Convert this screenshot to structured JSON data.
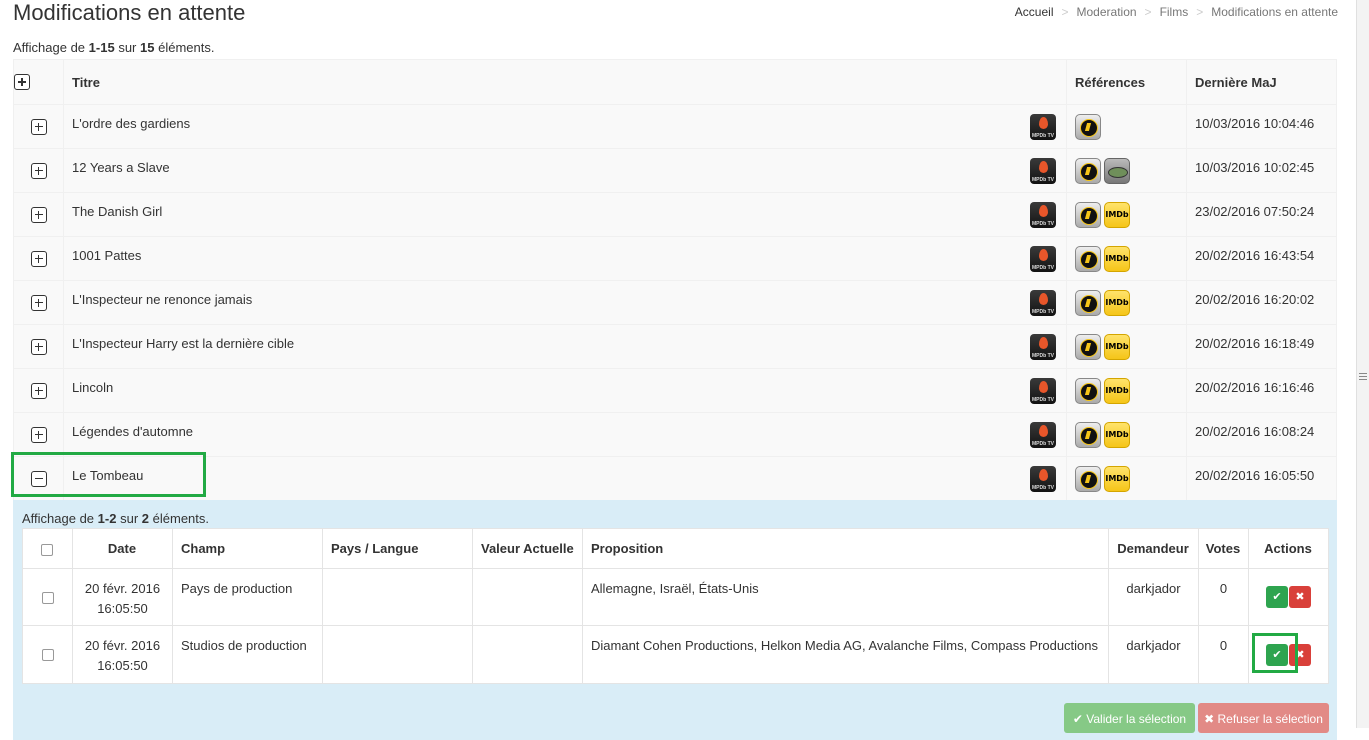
{
  "page": {
    "title": "Modifications en attente",
    "breadcrumb": [
      "Accueil",
      "Moderation",
      "Films",
      "Modifications en attente"
    ]
  },
  "summary": {
    "prefix": "Affichage de",
    "range": "1-15",
    "middle": "sur",
    "total": "15",
    "suffix": "éléments."
  },
  "main_table": {
    "headers": {
      "title": "Titre",
      "refs": "Références",
      "date": "Dernière MaJ"
    },
    "rows": [
      {
        "title": "L'ordre des gardiens",
        "refs": [
          "allocine"
        ],
        "date": "10/03/2016 10:04:46",
        "expanded": false
      },
      {
        "title": "12 Years a Slave",
        "refs": [
          "allocine",
          "disc"
        ],
        "date": "10/03/2016 10:02:45",
        "expanded": false
      },
      {
        "title": "The Danish Girl",
        "refs": [
          "allocine",
          "imdb"
        ],
        "date": "23/02/2016 07:50:24",
        "expanded": false
      },
      {
        "title": "1001 Pattes",
        "refs": [
          "allocine",
          "imdb"
        ],
        "date": "20/02/2016 16:43:54",
        "expanded": false
      },
      {
        "title": "L'Inspecteur ne renonce jamais",
        "refs": [
          "allocine",
          "imdb"
        ],
        "date": "20/02/2016 16:20:02",
        "expanded": false
      },
      {
        "title": "L'Inspecteur Harry est la dernière cible",
        "refs": [
          "allocine",
          "imdb"
        ],
        "date": "20/02/2016 16:18:49",
        "expanded": false
      },
      {
        "title": "Lincoln",
        "refs": [
          "allocine",
          "imdb"
        ],
        "date": "20/02/2016 16:16:46",
        "expanded": false
      },
      {
        "title": "Légendes d'automne",
        "refs": [
          "allocine",
          "imdb"
        ],
        "date": "20/02/2016 16:08:24",
        "expanded": false
      },
      {
        "title": "Le Tombeau",
        "refs": [
          "allocine",
          "imdb"
        ],
        "date": "20/02/2016 16:05:50",
        "expanded": true
      }
    ],
    "app_logo_label": "MPDb TV",
    "imdb_label": "IMDb"
  },
  "sub": {
    "summary": {
      "prefix": "Affichage de",
      "range": "1-2",
      "middle": "sur",
      "total": "2",
      "suffix": "éléments."
    },
    "headers": {
      "date": "Date",
      "champ": "Champ",
      "pays": "Pays / Langue",
      "valeur": "Valeur Actuelle",
      "proposition": "Proposition",
      "demandeur": "Demandeur",
      "votes": "Votes",
      "actions": "Actions"
    },
    "rows": [
      {
        "date_line1": "20 févr. 2016",
        "date_line2": "16:05:50",
        "champ": "Pays de production",
        "pays": "",
        "valeur": "",
        "proposition": "Allemagne, Israël, États-Unis",
        "demandeur": "darkjador",
        "votes": "0"
      },
      {
        "date_line1": "20 févr. 2016",
        "date_line2": "16:05:50",
        "champ": "Studios de production",
        "pays": "",
        "valeur": "",
        "proposition": "Diamant Cohen Productions, Helkon Media AG, Avalanche Films, Compass Productions",
        "demandeur": "darkjador",
        "votes": "0"
      }
    ],
    "approve_glyph": "✔",
    "reject_glyph": "✖"
  },
  "buttons": {
    "validate": "✔ Valider la sélection",
    "refuse": "✖ Refuser la sélection"
  },
  "colors": {
    "highlight": "#22aa44",
    "approve": "#2ea44f",
    "reject": "#d9403a",
    "panel": "#d9edf7"
  }
}
